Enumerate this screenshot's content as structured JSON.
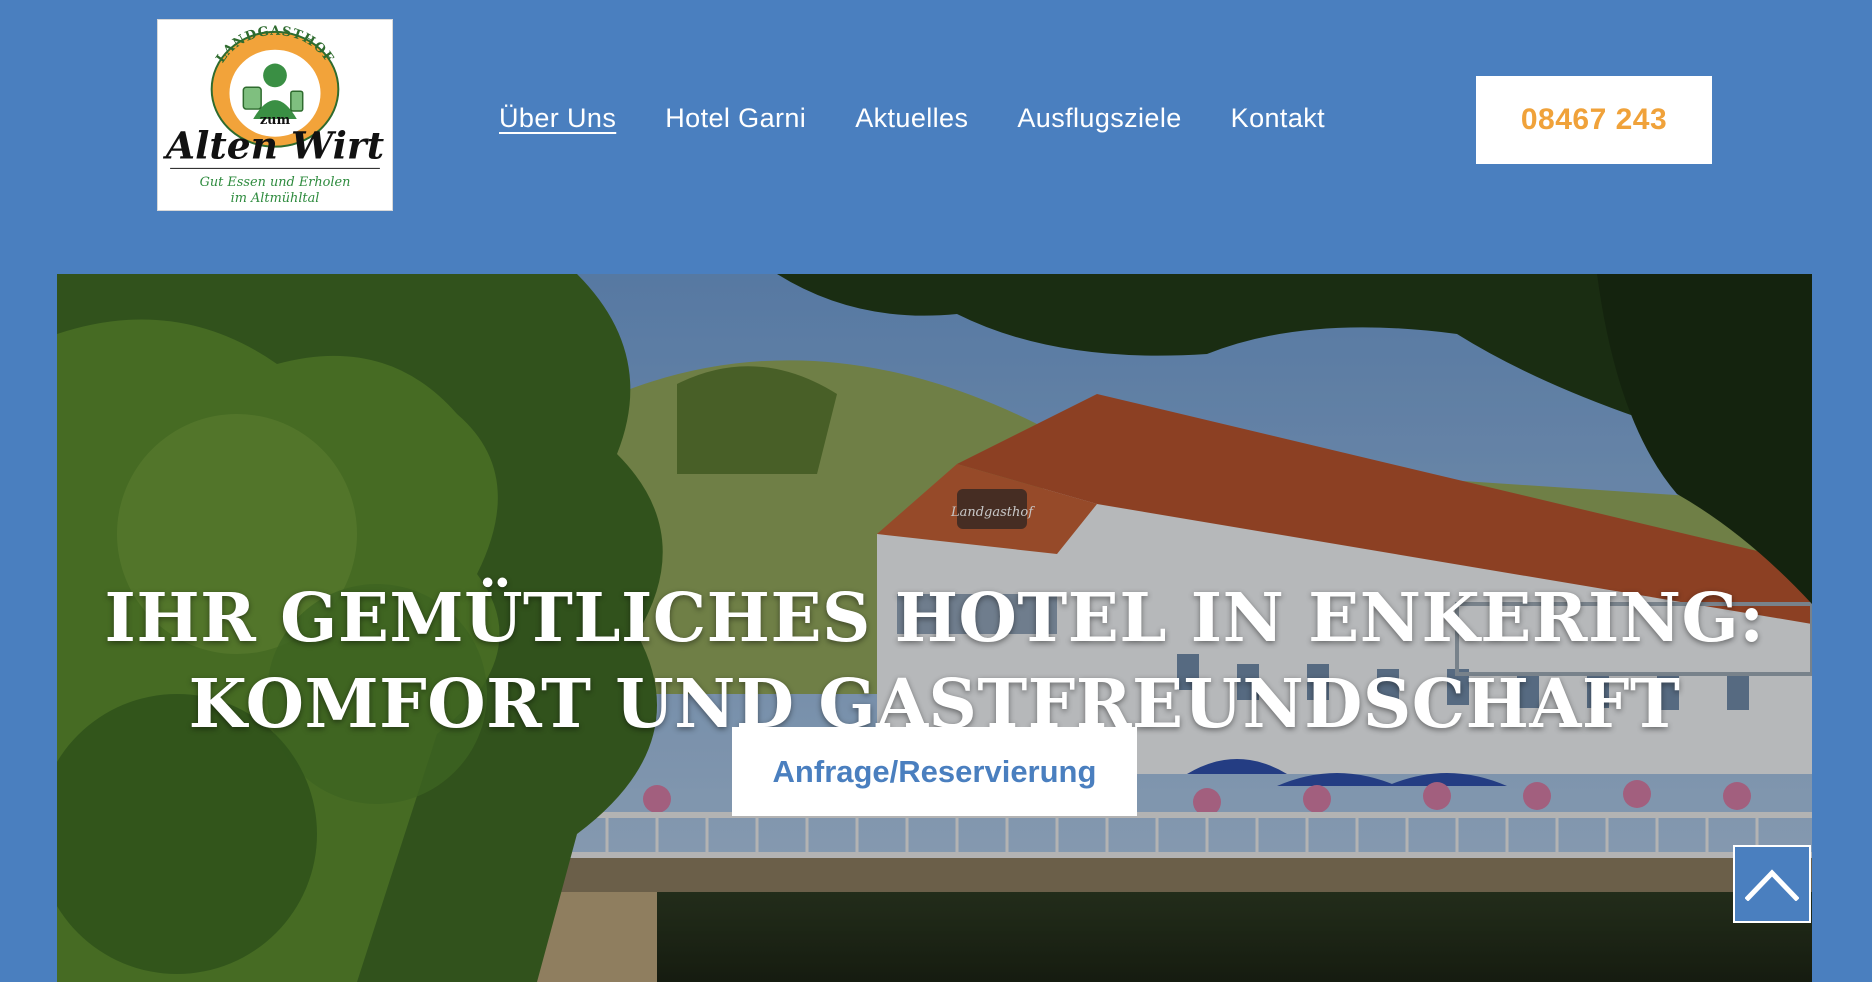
{
  "logo": {
    "top_text": "LANDGASTHOF",
    "small_text": "zum",
    "name": "Alten Wirt",
    "tagline_1": "Gut Essen und Erholen",
    "tagline_2": "im Altmühltal"
  },
  "nav": {
    "items": [
      {
        "label": "Über Uns",
        "active": true
      },
      {
        "label": "Hotel Garni",
        "active": false
      },
      {
        "label": "Aktuelles",
        "active": false
      },
      {
        "label": "Ausflugsziele",
        "active": false
      },
      {
        "label": "Kontakt",
        "active": false
      }
    ]
  },
  "phone": {
    "label": "08467 243"
  },
  "hero": {
    "title_line_1": "IHR GEMÜTLICHES HOTEL IN ENKERING:",
    "title_line_2": "KOMFORT UND GASTFREUNDSCHAFT",
    "sign_text": "Landgasthof",
    "cta_label": "Anfrage/Reservierung"
  },
  "scroll_top": {
    "icon": "chevron-up-icon"
  },
  "colors": {
    "brand_blue": "#4a7fbf",
    "phone_orange": "#f0a23a",
    "white": "#ffffff"
  }
}
